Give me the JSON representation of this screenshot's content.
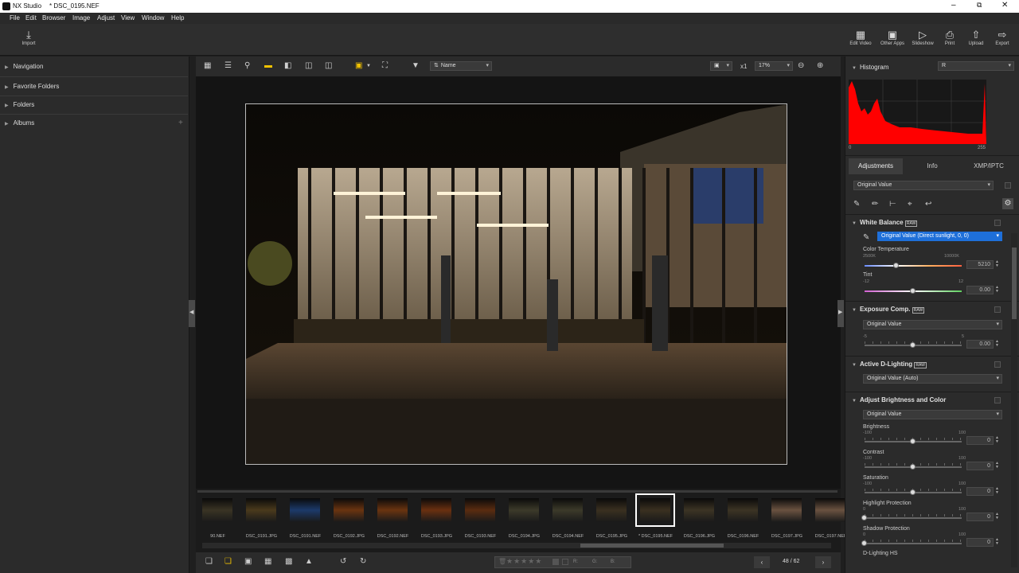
{
  "window": {
    "app_name": "NX Studio",
    "file_title": "* DSC_0195.NEF"
  },
  "menu": [
    "File",
    "Edit",
    "Browser",
    "Image",
    "Adjust",
    "View",
    "Window",
    "Help"
  ],
  "toolbar": {
    "import": "Import",
    "right": [
      "Edit Video",
      "Other Apps",
      "Slideshow",
      "Print",
      "Upload",
      "Export"
    ]
  },
  "left_panel": {
    "items": [
      "Navigation",
      "Favorite Folders",
      "Folders",
      "Albums"
    ]
  },
  "viewer_toolbar": {
    "sort_label": "Name",
    "zoom_x": "x1",
    "zoom_percent": "17%"
  },
  "filmstrip": {
    "thumbs": [
      {
        "label": "90.NEF",
        "color": "#3a3424"
      },
      {
        "label": "DSC_0191.JPG",
        "color": "#4a3a1c"
      },
      {
        "label": "DSC_0191.NEF",
        "color": "#1c3a6a"
      },
      {
        "label": "DSC_0192.JPG",
        "color": "#6a3410"
      },
      {
        "label": "DSC_0192.NEF",
        "color": "#6a3410"
      },
      {
        "label": "DSC_0193.JPG",
        "color": "#6a3010"
      },
      {
        "label": "DSC_0193.NEF",
        "color": "#5a2c10"
      },
      {
        "label": "DSC_0194.JPG",
        "color": "#3c3a2a"
      },
      {
        "label": "DSC_0194.NEF",
        "color": "#3c3a2a"
      },
      {
        "label": "DSC_0195.JPG",
        "color": "#3a3020"
      },
      {
        "label": "* DSC_0195.NEF",
        "color": "#3a3020"
      },
      {
        "label": "DSC_0196.JPG",
        "color": "#3c3424"
      },
      {
        "label": "DSC_0196.NEF",
        "color": "#3c3424"
      },
      {
        "label": "DSC_0197.JPG",
        "color": "#6a5240"
      },
      {
        "label": "DSC_0197.NEF",
        "color": "#6a5240"
      }
    ],
    "selected_index": 10
  },
  "bottom_bar": {
    "page": "48 / 62",
    "rgb": [
      "R:",
      "G:",
      "B:"
    ]
  },
  "histogram": {
    "title": "Histogram",
    "channel": "R",
    "min_label": "0",
    "max_label": "255"
  },
  "tabs": [
    "Adjustments",
    "Info",
    "XMP/IPTC"
  ],
  "preset": "Original Value",
  "white_balance": {
    "title": "White Balance",
    "badge": "RAW",
    "value": "Original Value (Direct sunlight, 0, 0)",
    "color_temp_label": "Color Temperature",
    "color_temp_min": "2500K",
    "color_temp_max": "10000K",
    "color_temp_value": "5210",
    "color_temp_level": 0.33,
    "tint_label": "Tint",
    "tint_min": "-12",
    "tint_max": "12",
    "tint_value": "0.00",
    "tint_level": 0.5
  },
  "exposure": {
    "title": "Exposure Comp.",
    "badge": "RAW",
    "value": "Original Value",
    "min": "-5",
    "max": "5",
    "number": "0.00",
    "level": 0.5
  },
  "adl": {
    "title": "Active D-Lighting",
    "badge": "RAW",
    "value": "Original Value (Auto)"
  },
  "abc": {
    "title": "Adjust Brightness and Color",
    "value": "Original Value",
    "sliders": [
      {
        "label": "Brightness",
        "min": "-100",
        "max": "100",
        "number": "0",
        "level": 0.5
      },
      {
        "label": "Contrast",
        "min": "-100",
        "max": "100",
        "number": "0",
        "level": 0.5
      },
      {
        "label": "Saturation",
        "min": "-100",
        "max": "100",
        "number": "0",
        "level": 0.5
      },
      {
        "label": "Highlight Protection",
        "min": "0",
        "max": "100",
        "number": "0",
        "level": 0
      },
      {
        "label": "Shadow Protection",
        "min": "0",
        "max": "100",
        "number": "0",
        "level": 0
      }
    ],
    "last_label": "D-Lighting HS"
  },
  "colors": {
    "selection": "#1e6fd9",
    "histogram": "#ff0000",
    "accent_yellow": "#f2c200"
  }
}
